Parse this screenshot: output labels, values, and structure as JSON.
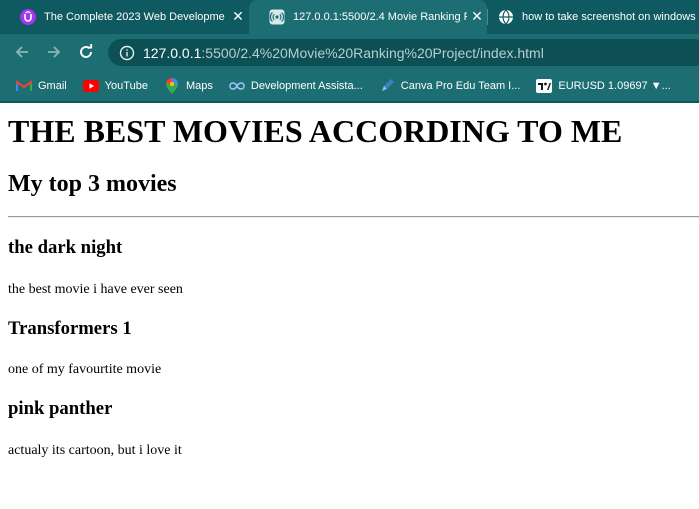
{
  "browser": {
    "tabs": [
      {
        "title": "The Complete 2023 Web Developme",
        "icon": "udemy-icon",
        "active": false
      },
      {
        "title": "127.0.0.1:5500/2.4 Movie Ranking P",
        "icon": "broadcast-icon",
        "active": true
      },
      {
        "title": "how to take screenshot on windows",
        "icon": "globe-icon",
        "active": false
      }
    ],
    "close_glyph": "✕",
    "address": {
      "host": "127.0.0.1",
      "rest": ":5500/2.4%20Movie%20Ranking%20Project/index.html"
    },
    "bookmarks": [
      {
        "label": "Gmail",
        "icon": "gmail-icon"
      },
      {
        "label": "YouTube",
        "icon": "youtube-icon"
      },
      {
        "label": "Maps",
        "icon": "maps-pin-icon"
      },
      {
        "label": "Development Assista...",
        "icon": "infinity-icon"
      },
      {
        "label": "Canva Pro Edu Team I...",
        "icon": "pen-icon"
      },
      {
        "label": "EURUSD 1.09697 ▼...",
        "icon": "tradingview-icon"
      }
    ],
    "colors": {
      "tabstrip": "#0f5a60",
      "toolbar": "#1c6e73",
      "omnibox": "#0c4f55"
    }
  },
  "page": {
    "heading": "THE BEST MOVIES ACCORDING TO ME",
    "subheading": "My top 3 movies",
    "movies": [
      {
        "title": "the dark night",
        "description": "the best movie i have ever seen"
      },
      {
        "title": "Transformers 1",
        "description": "one of my favourtite movie"
      },
      {
        "title": "pink panther",
        "description": "actualy its cartoon, but i love it"
      }
    ]
  }
}
